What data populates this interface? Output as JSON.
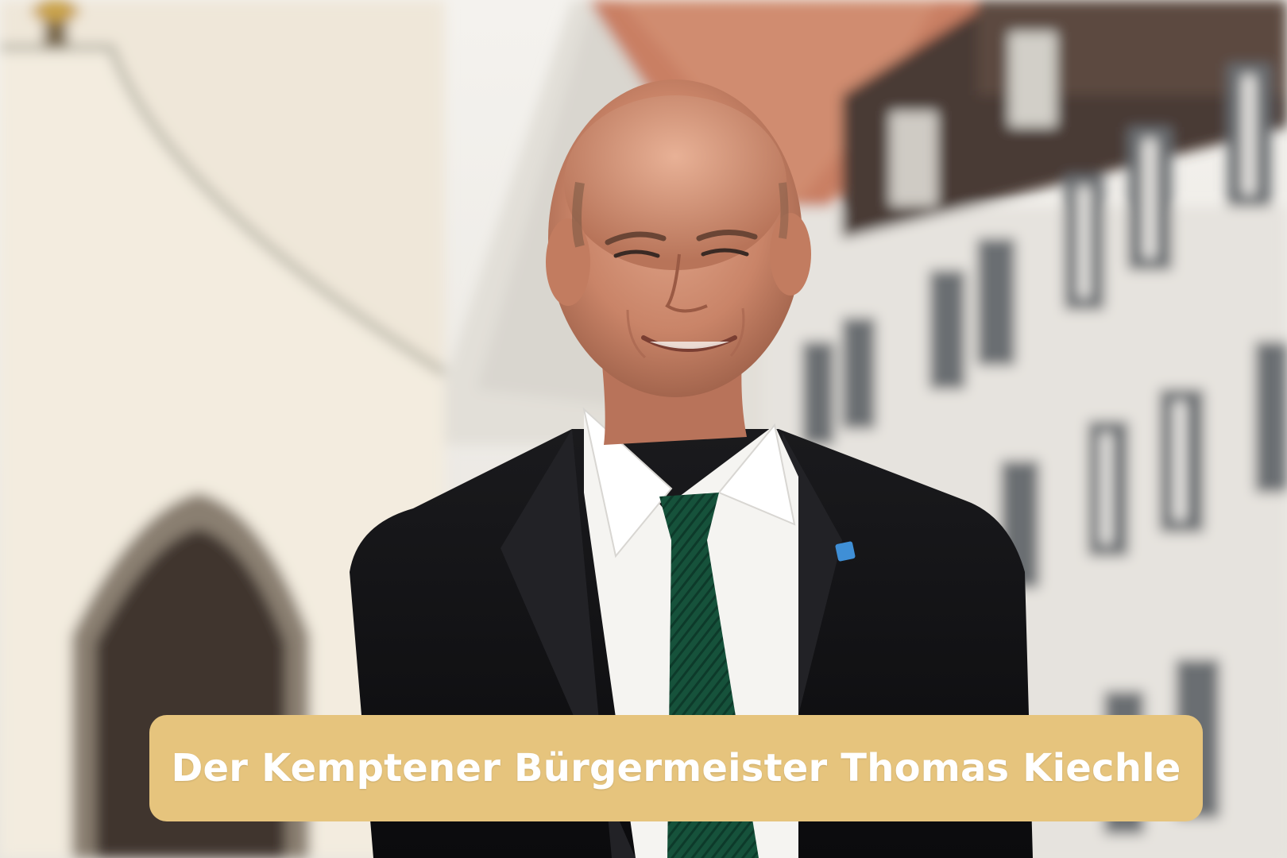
{
  "caption": {
    "text": "Der Kemptener Bürgermeister Thomas Kiechle",
    "background_color": "#e6c47d",
    "text_color": "#ffffff"
  },
  "photo": {
    "subject": "portrait-photo",
    "background": "blurred-historic-buildings"
  }
}
